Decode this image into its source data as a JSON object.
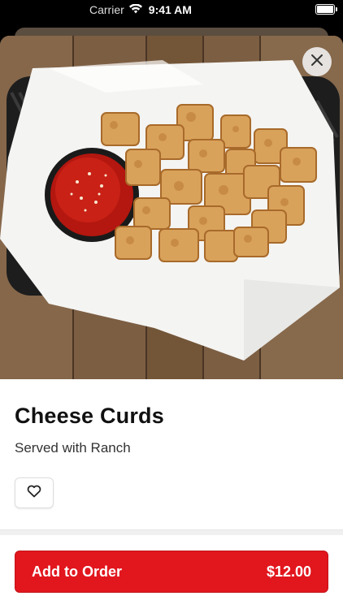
{
  "status_bar": {
    "carrier": "Carrier",
    "time": "9:41 AM"
  },
  "item": {
    "title": "Cheese Curds",
    "description": "Served with Ranch",
    "image_alt": "basket of fried cheese curds with marinara dipping sauce"
  },
  "icons": {
    "close": "close-icon",
    "favorite": "heart-icon",
    "wifi": "wifi-icon",
    "battery": "battery-icon"
  },
  "order_button": {
    "label": "Add to Order",
    "price": "$12.00"
  },
  "colors": {
    "accent": "#e2161d",
    "text": "#111111"
  }
}
